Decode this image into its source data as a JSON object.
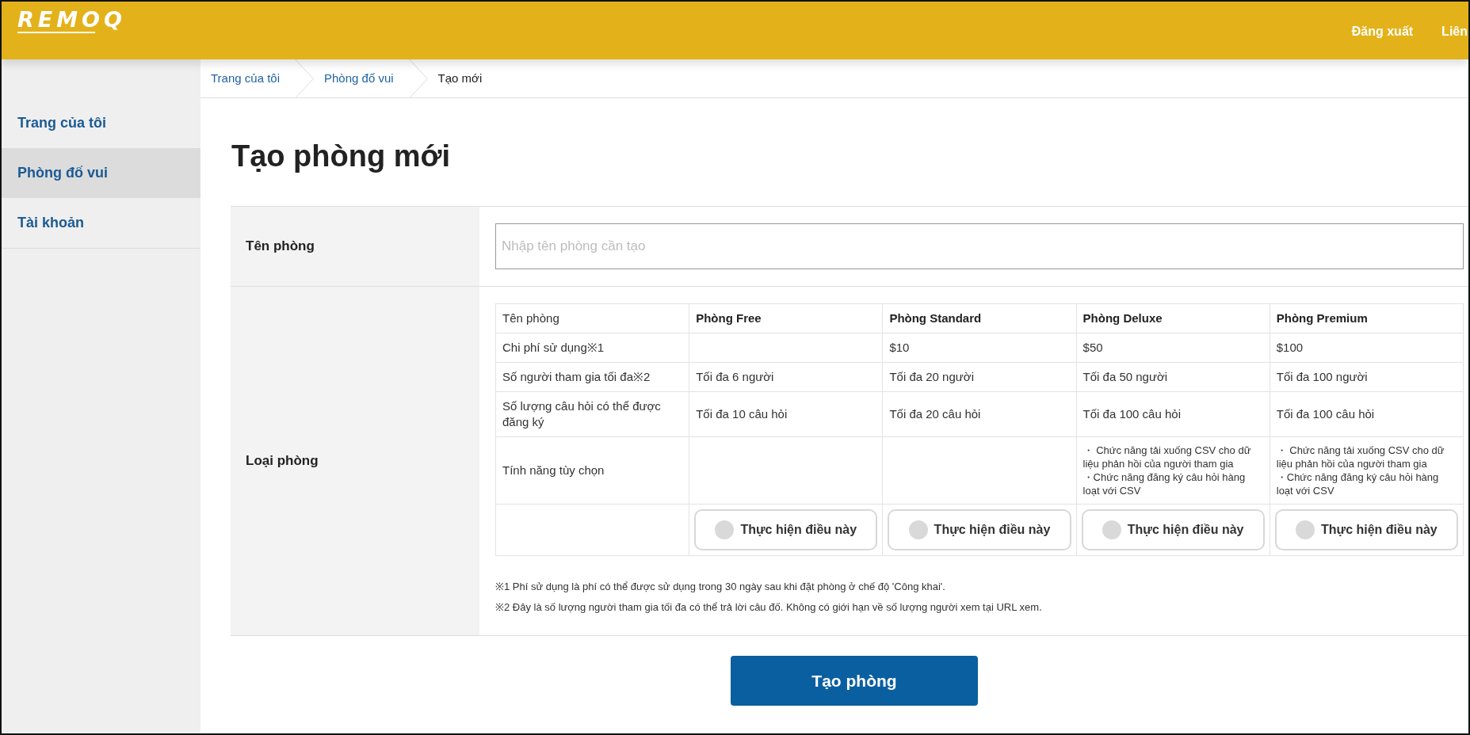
{
  "header": {
    "logo": "REMOQ",
    "nav": [
      "Đăng xuất",
      "Liên"
    ]
  },
  "sidebar": {
    "items": [
      {
        "label": "Trang của tôi",
        "selected": false
      },
      {
        "label": "Phòng đố vui",
        "selected": true
      },
      {
        "label": "Tài khoản",
        "selected": false
      }
    ]
  },
  "breadcrumb": [
    {
      "label": "Trang của tôi",
      "current": false
    },
    {
      "label": "Phòng đố vui",
      "current": false
    },
    {
      "label": "Tạo mới",
      "current": true
    }
  ],
  "page_title": "Tạo phòng mới",
  "form": {
    "name_field": {
      "label": "Tên phòng",
      "placeholder": "Nhập tên phòng cần tạo"
    },
    "room_type": {
      "label": "Loại phòng",
      "row_labels": [
        "Tên phòng",
        "Chi phí sử dụng※1",
        "Số người tham gia tối đa※2",
        "Số lượng câu hỏi có thể được đăng ký",
        "Tính năng tùy chọn"
      ],
      "plans": [
        {
          "name": "Phòng Free",
          "participants": "Tối đa 6 người",
          "questions": "Tối đa 10 câu hỏi",
          "button": "Thực hiện điều này",
          "selected": false
        },
        {
          "name": "Phòng Standard",
          "price": "$10",
          "participants": "Tối đa 20 người",
          "questions": "Tối đa 20 câu hỏi",
          "button": "Thực hiện điều này",
          "selected": false
        },
        {
          "name": "Phòng Deluxe",
          "price": "$50",
          "participants": "Tối đa 50 người",
          "questions": "Tối đa 100 câu hỏi",
          "options": [
            "・ Chức năng tải xuống CSV cho dữ liệu phản hồi của người tham gia",
            "・Chức năng đăng ký câu hỏi hàng loạt với CSV"
          ],
          "button": "Thực hiện điều này",
          "selected": false
        },
        {
          "name": "Phòng Premium",
          "price": "$100",
          "participants": "Tối đa 100 người",
          "questions": "Tối đa 100 câu hỏi",
          "options": [
            "・ Chức năng tải xuống CSV cho dữ liệu phản hồi của người tham gia",
            "・Chức năng đăng ký câu hỏi hàng loạt với CSV"
          ],
          "button": "Thực hiện điều này",
          "selected": false
        }
      ],
      "footnotes": [
        "※1 Phí sử dụng là phí có thể được sử dụng trong 30 ngày sau khi đặt phòng ở chế độ 'Công khai'.",
        "※2 Đây là số lượng người tham gia tối đa có thể trả lời câu đố. Không có giới hạn về số lượng người xem tại URL xem."
      ]
    }
  },
  "submit_button": "Tạo phòng"
}
